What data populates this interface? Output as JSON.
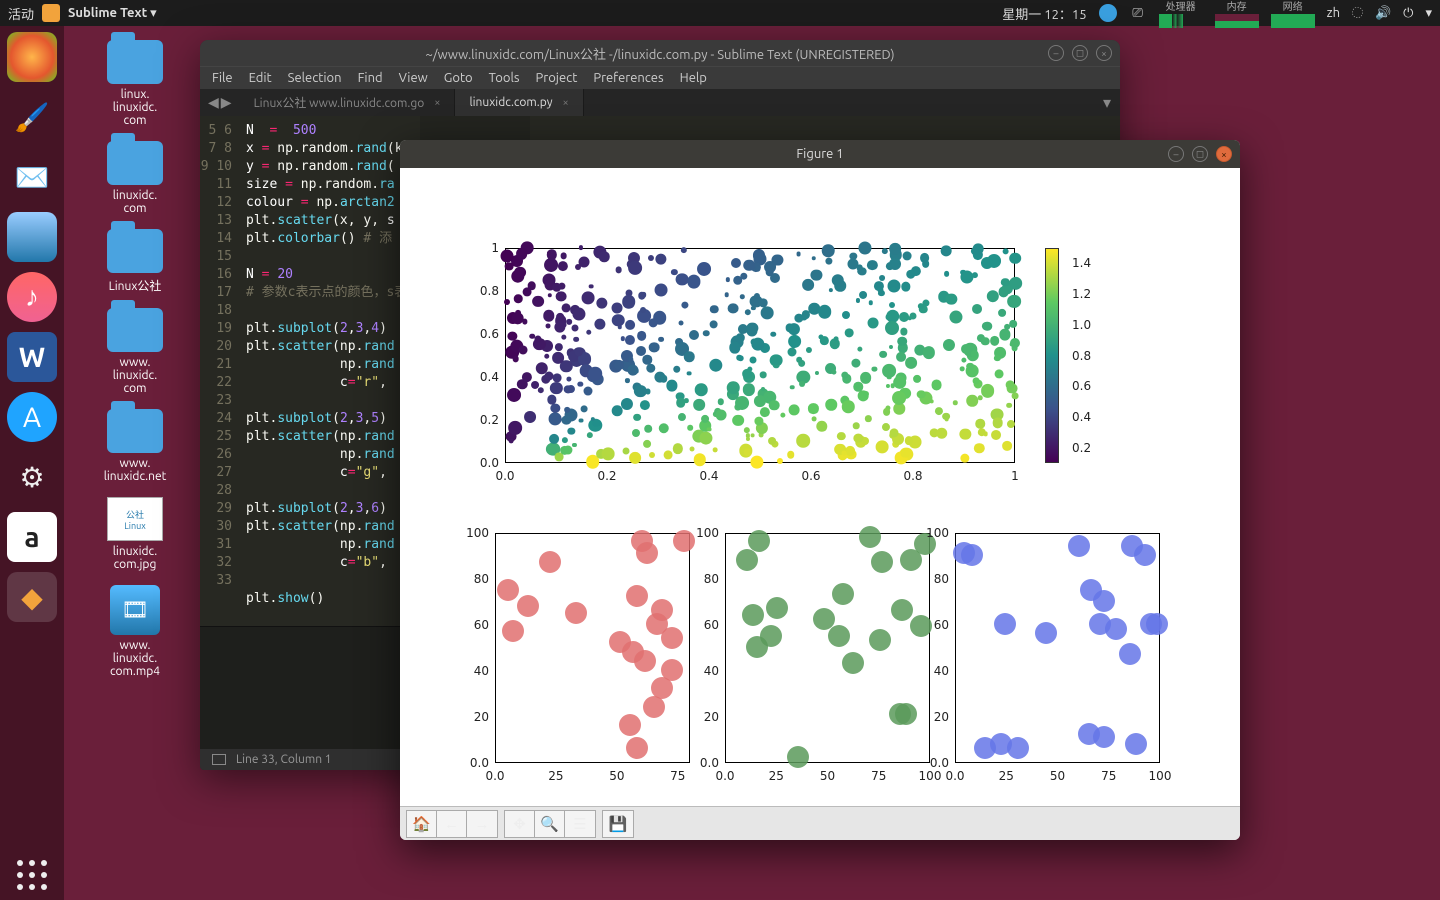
{
  "top_panel": {
    "activities": "活动",
    "app_name": "Sublime Text",
    "datetime": "星期一  12：15",
    "indicators": {
      "cpu": "处理器",
      "mem": "内存",
      "net": "网络"
    },
    "lang": "zh"
  },
  "dock": {
    "items": [
      "firefox",
      "drawing",
      "mail",
      "finder",
      "music",
      "word",
      "appstore",
      "devices",
      "amazon",
      "sublime"
    ]
  },
  "desktop": {
    "files": [
      {
        "type": "folder",
        "label": "linux.\nlinuxidc.\ncom"
      },
      {
        "type": "folder",
        "label": "linuxidc.\ncom"
      },
      {
        "type": "folder",
        "label": "Linux公社"
      },
      {
        "type": "folder",
        "label": "www.\nlinuxidc.\ncom"
      },
      {
        "type": "folder",
        "label": "www.\nlinuxidc.net"
      },
      {
        "type": "image",
        "label": "linuxidc.\ncom.jpg"
      },
      {
        "type": "video",
        "label": "www.\nlinuxidc.\ncom.mp4"
      }
    ]
  },
  "sublime": {
    "title": "~/www.linuxidc.com/Linux公社 -/linuxidc.com.py - Sublime Text (UNREGISTERED)",
    "menu": [
      "File",
      "Edit",
      "Selection",
      "Find",
      "View",
      "Goto",
      "Tools",
      "Project",
      "Preferences",
      "Help"
    ],
    "tabs": [
      {
        "label": "Linux公社 www.linuxidc.com.go",
        "active": false
      },
      {
        "label": "linuxidc.com.py",
        "active": true
      }
    ],
    "status": "Line 33, Column 1",
    "code_lines": {
      "start": 5,
      "end": 33
    }
  },
  "figure": {
    "title": "Figure 1",
    "toolbar": [
      "home",
      "back",
      "forward",
      "pan",
      "zoom",
      "subplots",
      "save"
    ]
  },
  "chart_data": [
    {
      "type": "scatter",
      "title": "",
      "xlabel": "",
      "ylabel": "",
      "xlim": [
        0.0,
        1.0
      ],
      "ylim": [
        0.0,
        1.0
      ],
      "xticks": [
        0.0,
        0.2,
        0.4,
        0.6,
        0.8,
        1.0
      ],
      "yticks": [
        0.0,
        0.2,
        0.4,
        0.6,
        0.8,
        1.0
      ],
      "n": 500,
      "colormap": "viridis",
      "color_by": "arctan2(y,x)",
      "colorbar_ticks": [
        0.2,
        0.4,
        0.6,
        0.8,
        1.0,
        1.2,
        1.4
      ],
      "note": "points uniformly random in [0,1]^2, sizes random"
    },
    {
      "type": "scatter",
      "title": "",
      "xlabel": "",
      "ylabel": "",
      "xlim": [
        0,
        80
      ],
      "ylim": [
        0,
        100
      ],
      "xticks": [
        0,
        25,
        50,
        75
      ],
      "yticks": [
        0,
        20,
        40,
        60,
        80,
        100
      ],
      "series": [
        {
          "name": "red",
          "color": "#e07070",
          "x": [
            5,
            7,
            13,
            22,
            33,
            51,
            55,
            56,
            58,
            58,
            60,
            61,
            62,
            65,
            66,
            68,
            68,
            72,
            72,
            77
          ],
          "y": [
            75,
            57,
            68,
            87,
            65,
            52,
            16,
            48,
            6,
            72,
            96,
            44,
            91,
            24,
            60,
            32,
            66,
            54,
            40,
            96
          ]
        }
      ]
    },
    {
      "type": "scatter",
      "title": "",
      "xlabel": "",
      "ylabel": "",
      "xlim": [
        0,
        100
      ],
      "ylim": [
        0,
        100
      ],
      "xticks": [
        0,
        25,
        50,
        75,
        100
      ],
      "yticks": [
        0,
        20,
        40,
        60,
        80,
        100
      ],
      "series": [
        {
          "name": "green",
          "color": "#5a9a5a",
          "x": [
            10,
            13,
            15,
            16,
            22,
            25,
            35,
            48,
            55,
            57,
            62,
            70,
            75,
            76,
            85,
            86,
            88,
            90,
            95,
            97
          ],
          "y": [
            88,
            64,
            50,
            96,
            55,
            67,
            2,
            62,
            55,
            73,
            43,
            98,
            53,
            87,
            21,
            66,
            21,
            88,
            59,
            95
          ]
        }
      ]
    },
    {
      "type": "scatter",
      "title": "",
      "xlabel": "",
      "ylabel": "",
      "xlim": [
        0,
        100
      ],
      "ylim": [
        0,
        100
      ],
      "xticks": [
        0,
        25,
        50,
        75,
        100
      ],
      "yticks": [
        0,
        20,
        40,
        60,
        80,
        100
      ],
      "series": [
        {
          "name": "blue",
          "color": "#6575e8",
          "x": [
            4,
            8,
            14,
            22,
            24,
            30,
            44,
            60,
            65,
            66,
            70,
            72,
            72,
            78,
            85,
            86,
            88,
            92,
            95,
            98
          ],
          "y": [
            91,
            90,
            6,
            8,
            60,
            6,
            56,
            94,
            12,
            75,
            60,
            11,
            70,
            58,
            47,
            94,
            8,
            90,
            60,
            60
          ]
        }
      ]
    }
  ]
}
